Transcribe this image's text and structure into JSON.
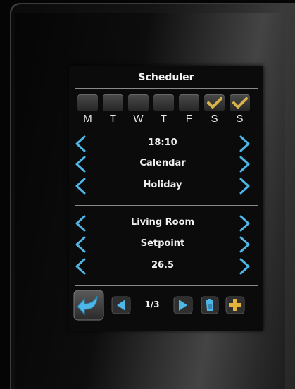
{
  "scheduler": {
    "title": "Scheduler",
    "days": [
      {
        "letter": "M",
        "checked": false
      },
      {
        "letter": "T",
        "checked": false
      },
      {
        "letter": "W",
        "checked": false
      },
      {
        "letter": "T",
        "checked": false
      },
      {
        "letter": "F",
        "checked": false
      },
      {
        "letter": "S",
        "checked": true
      },
      {
        "letter": "S",
        "checked": true
      }
    ],
    "rows_top": [
      "18:10",
      "Calendar",
      "Holiday"
    ],
    "rows_bottom": [
      "Living Room",
      "Setpoint",
      "26.5"
    ],
    "page": "1/3"
  },
  "icons": {
    "back": "back-arrow-icon",
    "prev": "prev-triangle-icon",
    "next": "next-triangle-icon",
    "delete": "trash-icon",
    "add": "plus-icon",
    "check": "checkmark-icon",
    "chevron_left": "chevron-left-icon",
    "chevron_right": "chevron-right-icon"
  },
  "colors": {
    "accent_blue": "#4fb6e8",
    "check_gold": "#d9b24a",
    "add_gold": "#e2b43c"
  }
}
